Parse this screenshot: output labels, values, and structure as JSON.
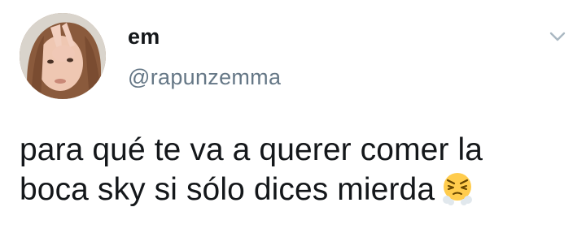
{
  "tweet": {
    "display_name": "em",
    "handle": "@rapunzemma",
    "text_line1": "para qué te va a querer comer la",
    "text_line2": "boca sky si sólo dices mierda",
    "emoji": "face-with-steam-from-nose-icon",
    "menu_icon": "chevron-down-icon"
  },
  "colors": {
    "name": "#14171a",
    "handle": "#657786",
    "text": "#14171a",
    "chevron": "#aab8c2",
    "emoji_face": "#ffcc4d"
  }
}
